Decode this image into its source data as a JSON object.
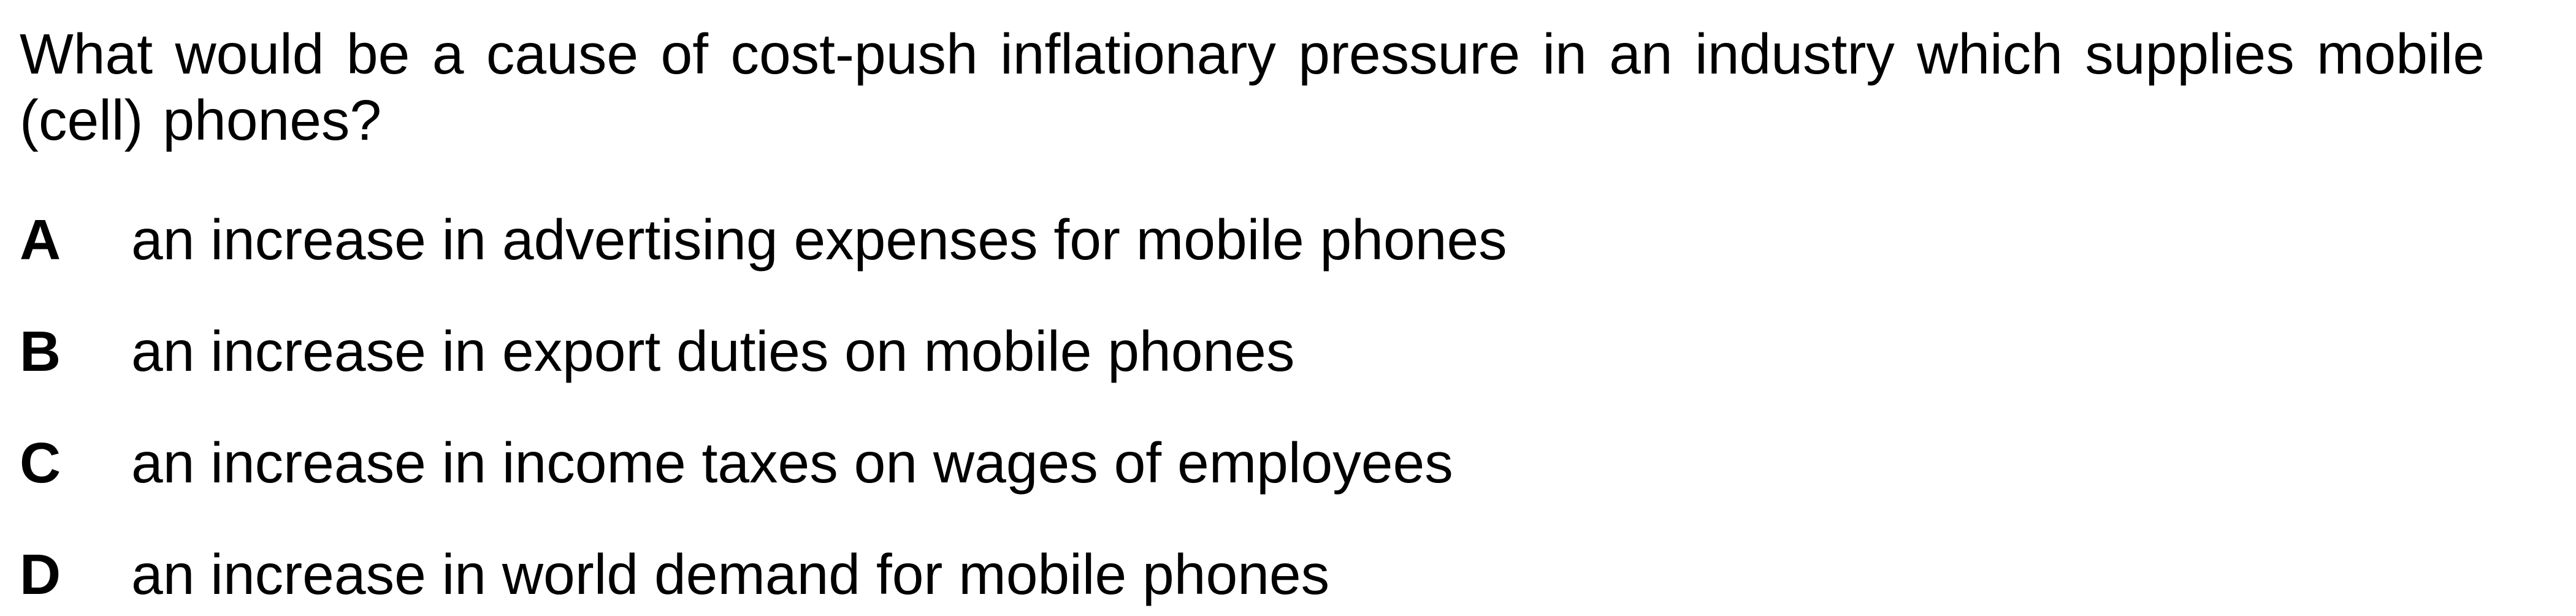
{
  "question": {
    "text": "What would be a cause of cost-push inflationary pressure in an industry which supplies mobile (cell) phones?"
  },
  "options": [
    {
      "letter": "A",
      "text": "an increase in advertising expenses for mobile phones"
    },
    {
      "letter": "B",
      "text": "an increase in export duties on mobile phones"
    },
    {
      "letter": "C",
      "text": "an increase in income taxes on wages of employees"
    },
    {
      "letter": "D",
      "text": "an increase in world demand for mobile phones"
    }
  ]
}
